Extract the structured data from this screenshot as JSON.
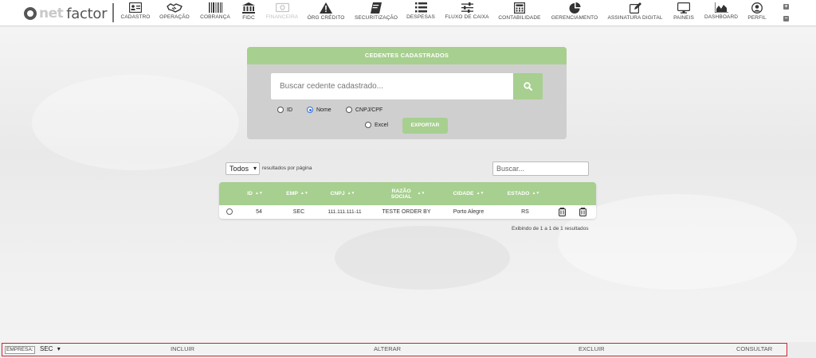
{
  "brand": {
    "logo_net": "net",
    "logo_factor": "factor"
  },
  "nav": {
    "items": [
      {
        "label": "CADASTRO",
        "icon": "id-card-icon"
      },
      {
        "label": "OPERAÇÃO",
        "icon": "handshake-icon"
      },
      {
        "label": "COBRANÇA",
        "icon": "barcode-icon"
      },
      {
        "label": "FIDC",
        "icon": "bank-icon"
      },
      {
        "label": "FINANCEIRA",
        "icon": "money-icon",
        "disabled": true
      },
      {
        "label": "ÓRG CRÉDITO",
        "icon": "warning-icon"
      },
      {
        "label": "SECURITIZAÇÃO",
        "icon": "book-icon"
      },
      {
        "label": "DESPESAS",
        "icon": "list-icon"
      },
      {
        "label": "FLUXO DE CAIXA",
        "icon": "sliders-icon"
      },
      {
        "label": "CONTABILIDADE",
        "icon": "calculator-icon"
      },
      {
        "label": "GERENCIAMENTO",
        "icon": "pie-chart-icon"
      },
      {
        "label": "ASSINATURA DIGITAL",
        "icon": "edit-icon"
      },
      {
        "label": "PAINEIS",
        "icon": "monitor-icon"
      },
      {
        "label": "DASHBOARD",
        "icon": "area-chart-icon"
      },
      {
        "label": "PERFIL",
        "icon": "user-circle-icon"
      }
    ],
    "expand_symbol": "+",
    "collapse_symbol": "−"
  },
  "panel": {
    "title": "CEDENTES CADASTRADOS",
    "search_placeholder": "Buscar cedente cadastrado...",
    "radio_options": [
      {
        "label": "ID",
        "checked": false
      },
      {
        "label": "Nome",
        "checked": true
      },
      {
        "label": "CNPJ/CPF",
        "checked": false
      }
    ],
    "excel_label": "Excel",
    "excel_checked": false,
    "export_label": "EXPORTAR"
  },
  "table": {
    "per_page_value": "Todos",
    "per_page_suffix": "resultados por página",
    "search_placeholder": "Buscar...",
    "sort_indicator": "▲▼",
    "columns": [
      "ID",
      "EMP",
      "CNPJ",
      "RAZÃO SOCIAL",
      "CIDADE",
      "ESTADO"
    ],
    "rows": [
      {
        "id": "54",
        "emp": "SEC",
        "cnpj": "111.111.111-11",
        "razao": "TESTE ORDER BY",
        "cidade": "Porto Alegre",
        "estado": "RS"
      }
    ],
    "result_info": "Exibindo de 1 a 1 de 1 resultados"
  },
  "footer": {
    "empresa_label": "EMPRESA:",
    "empresa_value": "SEC",
    "actions": [
      "INCLUIR",
      "ALTERAR",
      "EXCLUIR",
      "CONSULTAR"
    ]
  },
  "colors": {
    "accent": "#a7cf8f",
    "footer_border": "#d9232e"
  }
}
